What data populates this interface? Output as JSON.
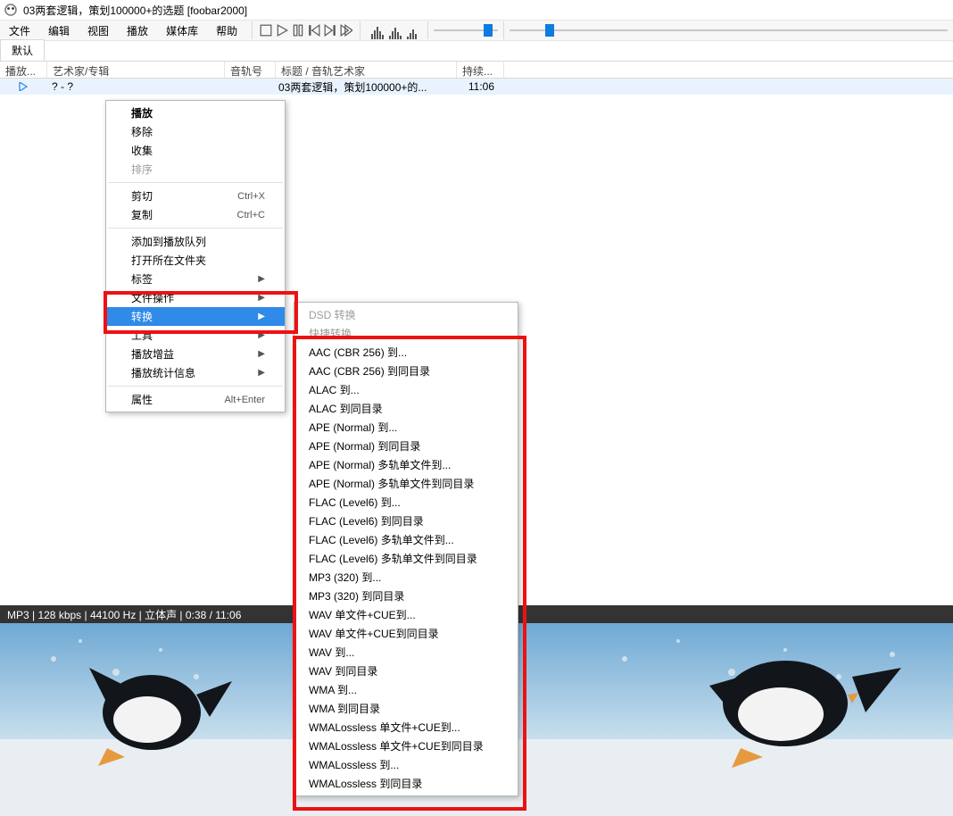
{
  "title": "03两套逻辑，策划100000+的选题  [foobar2000]",
  "menubar": [
    "文件",
    "编辑",
    "视图",
    "播放",
    "媒体库",
    "帮助"
  ],
  "toolbar_icons": [
    "stop",
    "play",
    "pause",
    "prev",
    "next",
    "random"
  ],
  "tabs": [
    "默认"
  ],
  "columns": {
    "playing": "播放...",
    "artist_album": "艺术家/专辑",
    "trackno": "音轨号",
    "title_artist": "标题 / 音轨艺术家",
    "duration": "持续..."
  },
  "row": {
    "artist_album": "?  -  ?",
    "trackno": "",
    "title": "03两套逻辑，策划100000+的...",
    "duration": "11:06"
  },
  "status": "MP3 | 128 kbps | 44100 Hz | 立体声 | 0:38 / 11:06",
  "context_menu": [
    {
      "t": "item",
      "label": "播放",
      "bold": true
    },
    {
      "t": "item",
      "label": "移除"
    },
    {
      "t": "item",
      "label": "收集"
    },
    {
      "t": "item",
      "label": "排序",
      "disabled": true
    },
    {
      "t": "sep"
    },
    {
      "t": "item",
      "label": "剪切",
      "accel": "Ctrl+X"
    },
    {
      "t": "item",
      "label": "复制",
      "accel": "Ctrl+C"
    },
    {
      "t": "sep"
    },
    {
      "t": "item",
      "label": "添加到播放队列"
    },
    {
      "t": "item",
      "label": "打开所在文件夹"
    },
    {
      "t": "item",
      "label": "标签",
      "arrow": true
    },
    {
      "t": "item",
      "label": "文件操作",
      "arrow": true
    },
    {
      "t": "item",
      "label": "转换",
      "arrow": true,
      "hi": true
    },
    {
      "t": "item",
      "label": "工具",
      "arrow": true
    },
    {
      "t": "item",
      "label": "播放增益",
      "arrow": true
    },
    {
      "t": "item",
      "label": "播放统计信息",
      "arrow": true
    },
    {
      "t": "sep"
    },
    {
      "t": "item",
      "label": "属性",
      "accel": "Alt+Enter"
    }
  ],
  "submenu": [
    {
      "t": "item",
      "label": "DSD 转换",
      "disabled": true
    },
    {
      "t": "item",
      "label": "快捷转换",
      "disabled": true
    },
    {
      "t": "sep"
    },
    {
      "t": "item",
      "label": "AAC (CBR 256) 到..."
    },
    {
      "t": "item",
      "label": "AAC (CBR 256) 到同目录"
    },
    {
      "t": "item",
      "label": "ALAC 到..."
    },
    {
      "t": "item",
      "label": "ALAC 到同目录"
    },
    {
      "t": "item",
      "label": "APE (Normal) 到..."
    },
    {
      "t": "item",
      "label": "APE (Normal) 到同目录"
    },
    {
      "t": "item",
      "label": "APE (Normal) 多轨单文件到..."
    },
    {
      "t": "item",
      "label": "APE (Normal) 多轨单文件到同目录"
    },
    {
      "t": "item",
      "label": "FLAC (Level6) 到..."
    },
    {
      "t": "item",
      "label": "FLAC (Level6) 到同目录"
    },
    {
      "t": "item",
      "label": "FLAC (Level6) 多轨单文件到..."
    },
    {
      "t": "item",
      "label": "FLAC (Level6) 多轨单文件到同目录"
    },
    {
      "t": "item",
      "label": "MP3 (320) 到..."
    },
    {
      "t": "item",
      "label": "MP3 (320) 到同目录"
    },
    {
      "t": "item",
      "label": "WAV 单文件+CUE到..."
    },
    {
      "t": "item",
      "label": "WAV 单文件+CUE到同目录"
    },
    {
      "t": "item",
      "label": "WAV 到..."
    },
    {
      "t": "item",
      "label": "WAV 到同目录"
    },
    {
      "t": "item",
      "label": "WMA 到..."
    },
    {
      "t": "item",
      "label": "WMA 到同目录"
    },
    {
      "t": "item",
      "label": "WMALossless 单文件+CUE到..."
    },
    {
      "t": "item",
      "label": "WMALossless 单文件+CUE到同目录"
    },
    {
      "t": "item",
      "label": "WMALossless 到..."
    },
    {
      "t": "item",
      "label": "WMALossless 到同目录"
    }
  ]
}
